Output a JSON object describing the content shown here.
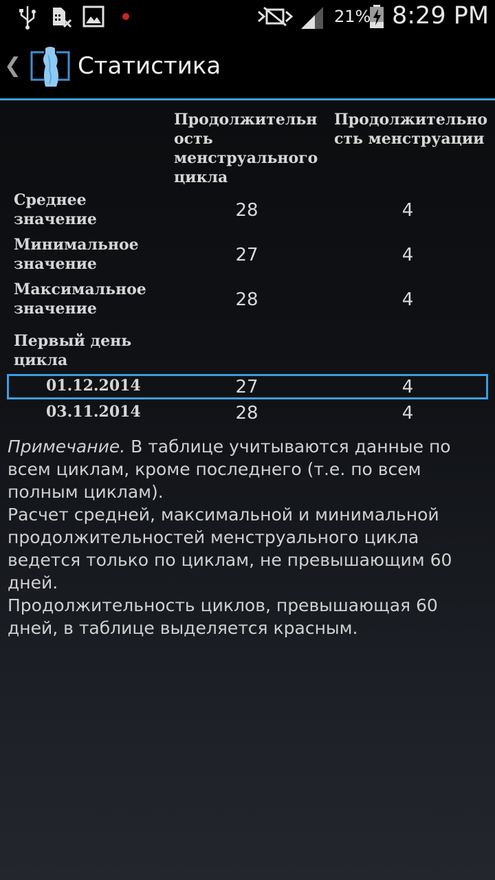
{
  "status_bar": {
    "battery_percent": "21%",
    "time": "8:29 PM",
    "icons": [
      "usb-icon",
      "sim-off-icon",
      "image-icon",
      "record-dot-icon",
      "mute-icon",
      "signal-icon",
      "battery-charging-icon"
    ]
  },
  "action_bar": {
    "back_glyph": "❮",
    "title": "Статистика"
  },
  "table": {
    "headers": {
      "cycle_length_lines": [
        "Продолжительн",
        "ость",
        "менструального",
        "цикла"
      ],
      "period_length_lines": [
        "Продолжительно",
        "сть менструации"
      ]
    },
    "summary_rows": [
      {
        "label_lines": [
          "Среднее",
          "значение"
        ],
        "cycle": "28",
        "period": "4"
      },
      {
        "label_lines": [
          "Минимальное",
          "значение"
        ],
        "cycle": "27",
        "period": "4"
      },
      {
        "label_lines": [
          "Максимальное",
          "значение"
        ],
        "cycle": "28",
        "period": "4"
      }
    ],
    "first_day_label_lines": [
      "Первый день",
      "цикла"
    ],
    "cycles": [
      {
        "date": "01.12.2014",
        "cycle": "27",
        "period": "4"
      },
      {
        "date": "03.11.2014",
        "cycle": "28",
        "period": "4"
      }
    ]
  },
  "note": {
    "label": "Примечание.",
    "line1_rest": " В таблице учитываются данные по всем циклам, кроме последнего (т.е. по всем полным циклам).",
    "paragraph2": "Расчет средней, максимальной и минимальной продолжительностей менструального цикла ведется только по циклам, не превышающим 60 дней.",
    "paragraph3": "Продолжительность циклов, превышающая 60 дней, в таблице выделяется красным."
  },
  "colors": {
    "accent": "#33a3dc",
    "selection": "#3f9de0",
    "icon_blue": "#7fc4f2",
    "record_red": "#c62828"
  }
}
